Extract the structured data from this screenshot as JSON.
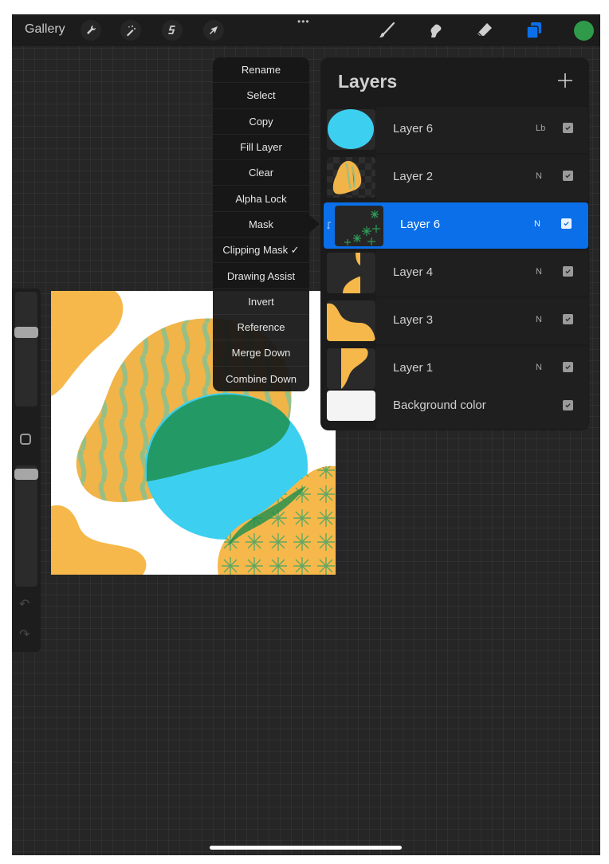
{
  "topbar": {
    "gallery_label": "Gallery",
    "left_tools": [
      {
        "name": "actions",
        "icon": "wrench-icon"
      },
      {
        "name": "adjustments",
        "icon": "magic-wand-icon"
      },
      {
        "name": "selection",
        "icon": "selection-s-icon"
      },
      {
        "name": "transform",
        "icon": "arrow-cursor-icon"
      }
    ],
    "more_label": "•••",
    "right_tools": [
      {
        "name": "paint",
        "icon": "brush-icon"
      },
      {
        "name": "smudge",
        "icon": "smudge-finger-icon"
      },
      {
        "name": "erase",
        "icon": "eraser-icon"
      },
      {
        "name": "layers",
        "icon": "layers-icon",
        "active": true
      },
      {
        "name": "colors",
        "icon": "color-swatch"
      }
    ],
    "current_color": "#2f9a4a",
    "accent_color": "#0a6fe8"
  },
  "sidebar": {
    "brush_size_label": "brush size slider",
    "opacity_label": "opacity slider",
    "undo_glyph": "↶",
    "redo_glyph": "↷"
  },
  "layer_menu": {
    "items": [
      {
        "label": "Rename"
      },
      {
        "label": "Select"
      },
      {
        "label": "Copy"
      },
      {
        "label": "Fill Layer"
      },
      {
        "label": "Clear"
      },
      {
        "label": "Alpha Lock"
      },
      {
        "label": "Mask"
      },
      {
        "label": "Clipping Mask ✓",
        "checked": true
      },
      {
        "label": "Drawing Assist"
      },
      {
        "label": "Invert"
      },
      {
        "label": "Reference"
      },
      {
        "label": "Merge Down"
      },
      {
        "label": "Combine Down"
      }
    ]
  },
  "layers_panel": {
    "title": "Layers",
    "add_label": "+",
    "layers": [
      {
        "name": "Layer 6",
        "blend": "Lb",
        "visible": true,
        "selected": false,
        "thumb": "cyan-circle"
      },
      {
        "name": "Layer 2",
        "blend": "N",
        "visible": true,
        "selected": false,
        "thumb": "pattern-blob"
      },
      {
        "name": "Layer 6",
        "blend": "N",
        "visible": true,
        "selected": true,
        "clipping": true,
        "thumb": "green-stars"
      },
      {
        "name": "Layer 4",
        "blend": "N",
        "visible": true,
        "selected": false,
        "thumb": "orange-edge"
      },
      {
        "name": "Layer 3",
        "blend": "N",
        "visible": true,
        "selected": false,
        "thumb": "orange-corner"
      },
      {
        "name": "Layer 1",
        "blend": "N",
        "visible": true,
        "selected": false,
        "thumb": "orange-bump"
      },
      {
        "name": "Background color",
        "blend": "",
        "visible": true,
        "selected": false,
        "thumb": "white"
      }
    ]
  }
}
